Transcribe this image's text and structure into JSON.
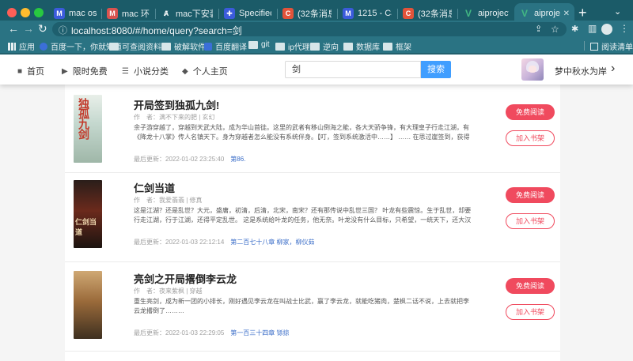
{
  "browser": {
    "tabs": [
      {
        "label": "mac os Ac",
        "icon": "m-icon",
        "color": "#3b5bdb"
      },
      {
        "label": "mac 环境",
        "icon": "m-icon",
        "color": "#d9534f"
      },
      {
        "label": "mac下安装",
        "icon": "a-icon",
        "color": "#ffffff"
      },
      {
        "label": "Specified",
        "icon": "puzzle-icon",
        "color": "#3b5bdb"
      },
      {
        "label": "(32条消息",
        "icon": "c-icon",
        "color": "#e2533a"
      },
      {
        "label": "1215 - Ca",
        "icon": "m-icon",
        "color": "#3b5bdb"
      },
      {
        "label": "(32条消息",
        "icon": "c-icon",
        "color": "#e2533a"
      },
      {
        "label": "aiproject",
        "icon": "v-icon",
        "color": "#42b883"
      },
      {
        "label": "aiproject",
        "icon": "v-icon",
        "color": "#42b883",
        "active": true
      }
    ],
    "url": "localhost:8080/#/home/query?search=剑",
    "bookmarks": [
      {
        "label": "应用",
        "icon": "apps-icon"
      },
      {
        "label": "百度一下，你就知道",
        "icon": "baidu-icon"
      },
      {
        "label": "可查阅资料",
        "icon": "folder-icon"
      },
      {
        "label": "破解软件",
        "icon": "folder-icon"
      },
      {
        "label": "百度翻译",
        "icon": "translate-icon"
      },
      {
        "label": "git",
        "icon": "folder-icon"
      },
      {
        "label": "ip代理",
        "icon": "folder-icon"
      },
      {
        "label": "逆向",
        "icon": "folder-icon"
      },
      {
        "label": "数据库",
        "icon": "folder-icon"
      },
      {
        "label": "框架",
        "icon": "folder-icon"
      }
    ],
    "reading_list": "阅读清单"
  },
  "header": {
    "nav": [
      {
        "label": "首页",
        "icon": "home-icon"
      },
      {
        "label": "限时免费",
        "icon": "lightning-icon"
      },
      {
        "label": "小说分类",
        "icon": "layers-icon"
      },
      {
        "label": "个人主页",
        "icon": "leaf-icon"
      }
    ],
    "search_value": "剑",
    "search_button": "搜索",
    "username": "梦中秋水为岸"
  },
  "books": [
    {
      "title": "开局签到独孤九剑!",
      "meta": "作　者：满不下来的肥 | 玄幻",
      "desc": "余子游穿越了，穿越到天武大陆，成为华山首徒。这里的武者有移山倒海之能，各大天骄争锋，有大理皇子行走江湖，有《降龙十八掌》传人名镇天下。身为穿越者怎么能没有系统伴身。【叮，签到系统激活中……】 …… 在思过崖签到，获得《独孤九剑》……",
      "update_label": "最后更新：",
      "update_time": "2022-01-02 23:25:40",
      "chapter": "第86.",
      "cover_text": "独孤九剑"
    },
    {
      "title": "仁剑当道",
      "meta": "作　者：我爱翡翡 | 修真",
      "desc": "这是江湖？还是乱世？大元，盛庸，初清，后清，北宋，南宋？还有那传说中乱世三国？ 叶龙有些震惊。生于乱世，却要行走江湖，行于江湖，还得平定乱世。 这是系统给叶龙的任务，他无奈。叶龙没有什么目标，只希望，一统天下，还大汉子民，太平……",
      "update_label": "最后更新：",
      "update_time": "2022-01-03 22:12:14",
      "chapter": "第二百七十八章 柳家，柳仪茹",
      "cover_text": "仁剑当道"
    },
    {
      "title": "亮剑之开局撂倒李云龙",
      "meta": "作　者：夜来紫枫 | 穿越",
      "desc": "重生亮剑，成为新一团的小排长，刚好遇见李云龙在叫战士比武，赢了李云龙，就能吃猪肉，楚枫二话不说，上去就把李云龙撂倒了………",
      "update_label": "最后更新：",
      "update_time": "2022-01-03 22:29:05",
      "chapter": "第一百三十四章 铩掠",
      "cover_text": ""
    }
  ],
  "actions": {
    "read": "免费阅读",
    "shelf": "加入书架"
  },
  "colors": {
    "accent": "#f04a5e",
    "search": "#409eff",
    "chrome": "#2a7383"
  }
}
